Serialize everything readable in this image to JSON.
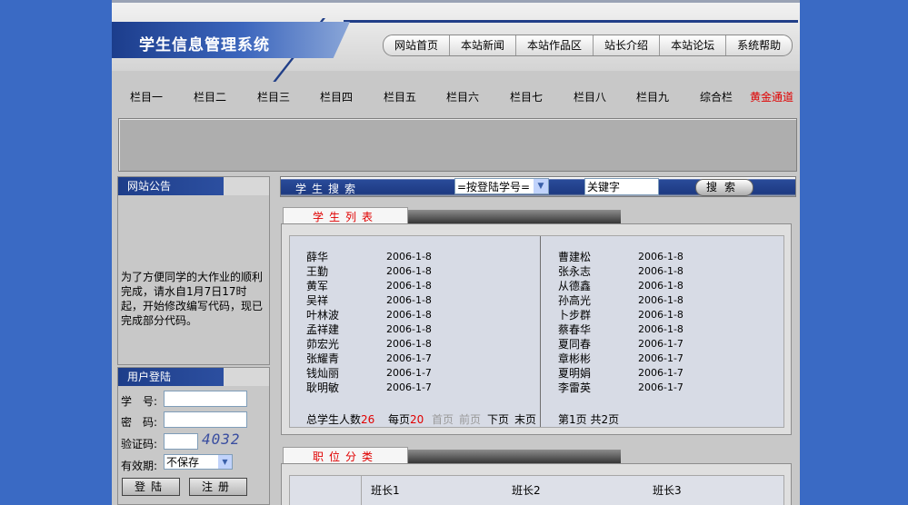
{
  "header": {
    "site_title": "学生信息管理系统",
    "top_nav": [
      "网站首页",
      "本站新闻",
      "本站作品区",
      "站长介绍",
      "本站论坛",
      "系统帮助"
    ]
  },
  "category_nav": {
    "items": [
      "栏目一",
      "栏目二",
      "栏目三",
      "栏目四",
      "栏目五",
      "栏目六",
      "栏目七",
      "栏目八",
      "栏目九",
      "综合栏"
    ],
    "special": "黄金通道",
    "special_color": "#e00000"
  },
  "notice": {
    "title": "网站公告",
    "text": "为了方便同学的大作业的顺利完成，请水自1月7日17时起，开始修改编写代码，现已完成部分代码。"
  },
  "login": {
    "title": "用户登陆",
    "student_id_label": "学　号:",
    "password_label": "密　码:",
    "captcha_label": "验证码:",
    "captcha_code": "4032",
    "validity_label": "有效期:",
    "validity_value": "不保存",
    "login_button": "登陆",
    "register_button": "注册"
  },
  "search": {
    "title": "学生搜索",
    "select_value": "=按登陆学号=",
    "keyword_value": "关键字",
    "button_label": "搜索"
  },
  "student_list": {
    "title": "学生列表",
    "left": [
      {
        "name": "薛华",
        "date": "2006-1-8"
      },
      {
        "name": "王勤",
        "date": "2006-1-8"
      },
      {
        "name": "黄军",
        "date": "2006-1-8"
      },
      {
        "name": "吴祥",
        "date": "2006-1-8"
      },
      {
        "name": "叶林波",
        "date": "2006-1-8"
      },
      {
        "name": "孟祥建",
        "date": "2006-1-8"
      },
      {
        "name": "茆宏光",
        "date": "2006-1-8"
      },
      {
        "name": "张耀青",
        "date": "2006-1-7"
      },
      {
        "name": "钱灿丽",
        "date": "2006-1-7"
      },
      {
        "name": "耿明敏",
        "date": "2006-1-7"
      }
    ],
    "right": [
      {
        "name": "曹建松",
        "date": "2006-1-8"
      },
      {
        "name": "张永志",
        "date": "2006-1-8"
      },
      {
        "name": "从德鑫",
        "date": "2006-1-8"
      },
      {
        "name": "孙高光",
        "date": "2006-1-8"
      },
      {
        "name": "卜步群",
        "date": "2006-1-8"
      },
      {
        "name": "蔡春华",
        "date": "2006-1-8"
      },
      {
        "name": "夏同春",
        "date": "2006-1-7"
      },
      {
        "name": "章彬彬",
        "date": "2006-1-7"
      },
      {
        "name": "夏明娟",
        "date": "2006-1-7"
      },
      {
        "name": "李雷英",
        "date": "2006-1-7"
      }
    ],
    "total_label": "总学生人数",
    "total_value": "26",
    "per_page_label": "每页",
    "per_page_value": "20",
    "first_label": "首页",
    "prev_label": "前页",
    "next_label": "下页",
    "last_label": "末页",
    "page_info": "第1页 共2页"
  },
  "positions": {
    "title": "职位分类",
    "items": [
      "班长1",
      "班长2",
      "班长3"
    ]
  }
}
